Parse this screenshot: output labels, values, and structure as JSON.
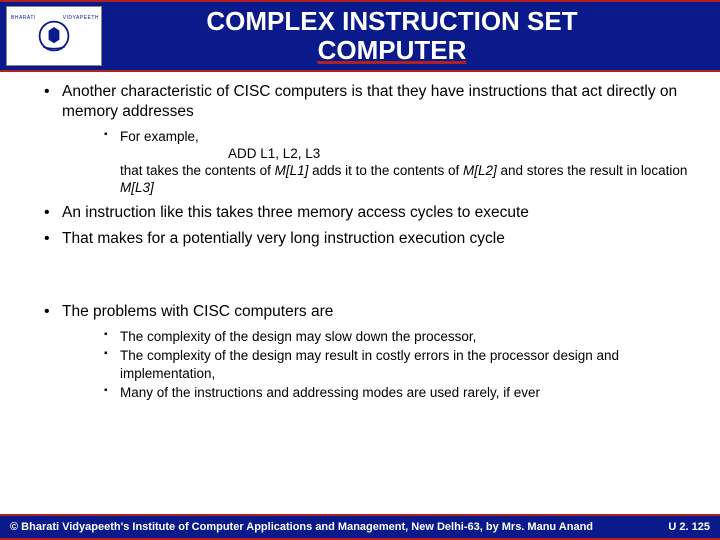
{
  "title_line1": "COMPLEX INSTRUCTION SET",
  "title_line2": "COMPUTER",
  "emblem_top": "BHARATI",
  "emblem_right": "VIDYAPEETH",
  "bullets": {
    "b1": "Another characteristic of CISC computers is that they have instructions that act directly on memory addresses",
    "b1_sub_a": "For example,",
    "b1_sub_b": "ADD L1, L2, L3",
    "b1_sub_c_pre": "that takes the contents of ",
    "b1_sub_c_i1": "M[L1]",
    "b1_sub_c_mid": " adds it to the contents of ",
    "b1_sub_c_i2": "M[L2]",
    "b1_sub_c_end": " and stores the result in location ",
    "b1_sub_c_i3": "M[L3]",
    "b2": "An instruction like this takes three memory access cycles to execute",
    "b3": "That makes for a potentially very long instruction execution cycle",
    "b4": "The problems with CISC computers are",
    "b4_sub1": "The complexity of the design may slow down the processor,",
    "b4_sub2": "The complexity of the design may result in costly errors in the processor design and implementation,",
    "b4_sub3": "Many of the instructions and addressing modes are used rarely, if ever"
  },
  "footer_left": "© Bharati Vidyapeeth's Institute of Computer Applications and Management, New Delhi-63, by Mrs. Manu Anand",
  "footer_right": "U 2. 125"
}
